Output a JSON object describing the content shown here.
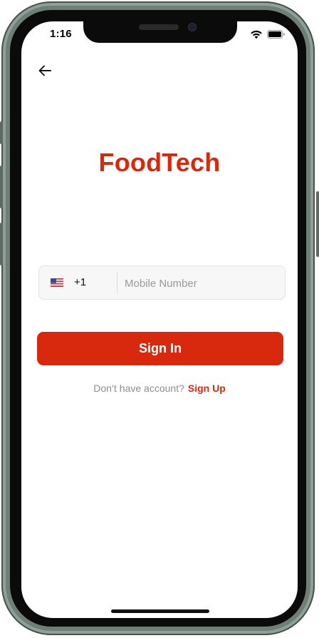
{
  "status_bar": {
    "time": "1:16",
    "icons": [
      "wifi-icon",
      "battery-icon"
    ]
  },
  "header": {
    "back_icon": "arrow-left-icon"
  },
  "brand": {
    "name": "FoodTech",
    "color": "#d8290f"
  },
  "phone_field": {
    "flag_icon": "us-flag-icon",
    "country_code": "+1",
    "placeholder": "Mobile Number",
    "value": ""
  },
  "actions": {
    "sign_in_label": "Sign In",
    "account_prompt": "Don’t have account?",
    "sign_up_label": "Sign Up"
  },
  "colors": {
    "accent": "#d8290f",
    "muted_text": "#8d8d8d"
  }
}
